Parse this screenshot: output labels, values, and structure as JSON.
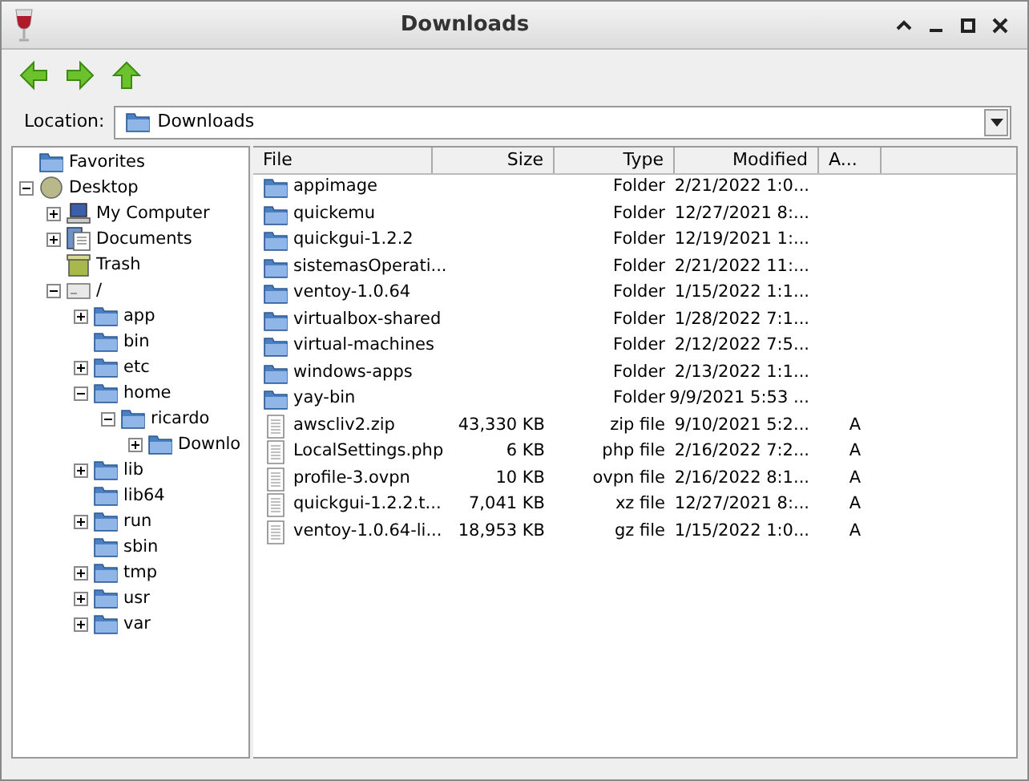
{
  "window": {
    "title": "Downloads"
  },
  "location": {
    "label": "Location:",
    "value": "Downloads"
  },
  "tree": [
    {
      "label": "Favorites",
      "kind": "folder"
    },
    {
      "label": "Desktop",
      "kind": "desktop",
      "expanded": true,
      "children": [
        {
          "label": "My Computer",
          "kind": "computer",
          "expanded": false
        },
        {
          "label": "Documents",
          "kind": "documents",
          "expanded": false
        },
        {
          "label": "Trash",
          "kind": "trash"
        },
        {
          "label": "/",
          "kind": "drive",
          "expanded": true,
          "children": [
            {
              "label": "app",
              "kind": "folder",
              "expanded": false
            },
            {
              "label": "bin",
              "kind": "folder"
            },
            {
              "label": "etc",
              "kind": "folder",
              "expanded": false
            },
            {
              "label": "home",
              "kind": "folder",
              "expanded": true,
              "children": [
                {
                  "label": "ricardo",
                  "kind": "folder",
                  "expanded": true,
                  "children": [
                    {
                      "label": "Downlo",
                      "kind": "folder",
                      "expanded": false
                    }
                  ]
                }
              ]
            },
            {
              "label": "lib",
              "kind": "folder",
              "expanded": false
            },
            {
              "label": "lib64",
              "kind": "folder"
            },
            {
              "label": "run",
              "kind": "folder",
              "expanded": false
            },
            {
              "label": "sbin",
              "kind": "folder"
            },
            {
              "label": "tmp",
              "kind": "folder",
              "expanded": false
            },
            {
              "label": "usr",
              "kind": "folder",
              "expanded": false
            },
            {
              "label": "var",
              "kind": "folder",
              "expanded": false
            }
          ]
        }
      ]
    }
  ],
  "table": {
    "columns": [
      "File",
      "Size",
      "Type",
      "Modified",
      "A..."
    ],
    "rows": [
      {
        "kind": "folder",
        "cells": [
          "appimage",
          "",
          "Folder",
          "2/21/2022 1:0...",
          ""
        ]
      },
      {
        "kind": "folder",
        "cells": [
          "quickemu",
          "",
          "Folder",
          "12/27/2021 8:...",
          ""
        ]
      },
      {
        "kind": "folder",
        "cells": [
          "quickgui-1.2.2",
          "",
          "Folder",
          "12/19/2021 1:...",
          ""
        ]
      },
      {
        "kind": "folder",
        "cells": [
          "sistemasOperati...",
          "",
          "Folder",
          "2/21/2022 11:...",
          ""
        ]
      },
      {
        "kind": "folder",
        "cells": [
          "ventoy-1.0.64",
          "",
          "Folder",
          "1/15/2022 1:1...",
          ""
        ]
      },
      {
        "kind": "folder",
        "cells": [
          "virtualbox-shared",
          "",
          "Folder",
          "1/28/2022 7:1...",
          ""
        ]
      },
      {
        "kind": "folder",
        "cells": [
          "virtual-machines",
          "",
          "Folder",
          "2/12/2022 7:5...",
          ""
        ]
      },
      {
        "kind": "folder",
        "cells": [
          "windows-apps",
          "",
          "Folder",
          "2/13/2022 1:1...",
          ""
        ]
      },
      {
        "kind": "folder",
        "cells": [
          "yay-bin",
          "",
          "Folder",
          "9/9/2021 5:53 ...",
          ""
        ]
      },
      {
        "kind": "file",
        "cells": [
          "awscliv2.zip",
          "43,330 KB",
          "zip file",
          "9/10/2021 5:2...",
          "A"
        ]
      },
      {
        "kind": "file",
        "cells": [
          "LocalSettings.php",
          "6 KB",
          "php file",
          "2/16/2022 7:2...",
          "A"
        ]
      },
      {
        "kind": "file",
        "cells": [
          "profile-3.ovpn",
          "10 KB",
          "ovpn file",
          "2/16/2022 8:1...",
          "A"
        ]
      },
      {
        "kind": "file",
        "cells": [
          "quickgui-1.2.2.t...",
          "7,041 KB",
          "xz file",
          "12/27/2021 8:...",
          "A"
        ]
      },
      {
        "kind": "file",
        "cells": [
          "ventoy-1.0.64-li...",
          "18,953 KB",
          "gz file",
          "1/15/2022 1:0...",
          "A"
        ]
      }
    ]
  }
}
